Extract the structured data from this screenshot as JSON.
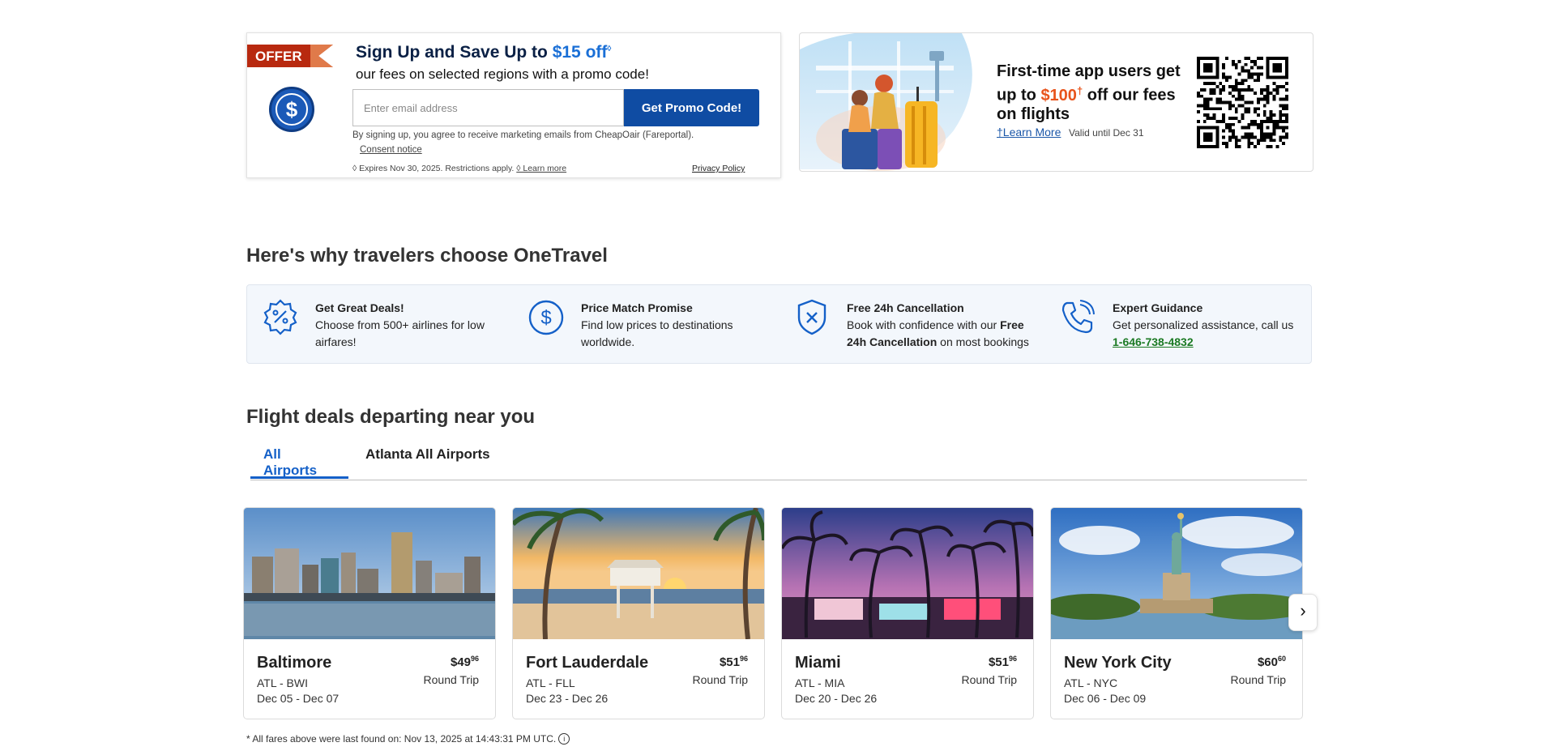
{
  "promo": {
    "badge": "OFFER",
    "title_prefix": "Sign Up and Save Up to",
    "title_amount": "$15 off",
    "title_mark": "◊",
    "subtitle": "our fees on selected regions with a promo code!",
    "email_placeholder": "Enter email address",
    "button_label": "Get Promo Code!",
    "disclaimer": "By signing up, you agree to receive marketing emails from CheapOair (Fareportal).",
    "consent_link": "Consent notice",
    "expires": "◊ Expires Nov 30, 2025. Restrictions apply.",
    "learn_more": "◊ Learn more",
    "privacy": "Privacy Policy"
  },
  "app_promo": {
    "line1": "First-time app users get up to",
    "amount": "$100",
    "dagger": "†",
    "line2": "off our fees on flights",
    "learn_more": "†Learn More",
    "valid": "Valid until Dec 31"
  },
  "why": {
    "title": "Here's why travelers choose OneTravel",
    "items": [
      {
        "heading": "Get Great Deals!",
        "text": "Choose from 500+ airlines for low airfares!",
        "icon": "discount-badge-icon"
      },
      {
        "heading": "Price Match Promise",
        "text": "Find low prices to destinations worldwide.",
        "icon": "dollar-circle-icon"
      },
      {
        "heading": "Free 24h Cancellation",
        "text_prefix": "Book with confidence with our",
        "text_bold": "Free 24h Cancellation",
        "text_suffix": "on most bookings",
        "icon": "shield-x-icon"
      },
      {
        "heading": "Expert Guidance",
        "text": "Get personalized assistance, call us",
        "phone": "1-646-738-4832",
        "icon": "phone-icon"
      }
    ]
  },
  "deals": {
    "title": "Flight deals departing near you",
    "tabs": [
      "All Airports",
      "Atlanta All Airports"
    ],
    "cards": [
      {
        "city": "Baltimore",
        "route": "ATL - BWI",
        "dates": "Dec 05 - Dec 07",
        "price": "$49",
        "cents": "96",
        "trip": "Round Trip"
      },
      {
        "city": "Fort Lauderdale",
        "route": "ATL - FLL",
        "dates": "Dec 23 - Dec 26",
        "price": "$51",
        "cents": "96",
        "trip": "Round Trip"
      },
      {
        "city": "Miami",
        "route": "ATL - MIA",
        "dates": "Dec 20 - Dec 26",
        "price": "$51",
        "cents": "96",
        "trip": "Round Trip"
      },
      {
        "city": "New York City",
        "route": "ATL - NYC",
        "dates": "Dec 06 - Dec 09",
        "price": "$60",
        "cents": "60",
        "trip": "Round Trip"
      }
    ],
    "next_icon": "chevron-right-icon",
    "next_glyph": "›"
  },
  "footnote": "* All fares above were last found on: Nov 13, 2025 at 14:43:31 PM UTC.",
  "colors": {
    "brand_blue": "#0f4ca3",
    "accent_blue": "#1a6fd6",
    "offer_red": "#b8290f",
    "promo_orange": "#e8541c",
    "phone_green": "#1b7a23"
  }
}
